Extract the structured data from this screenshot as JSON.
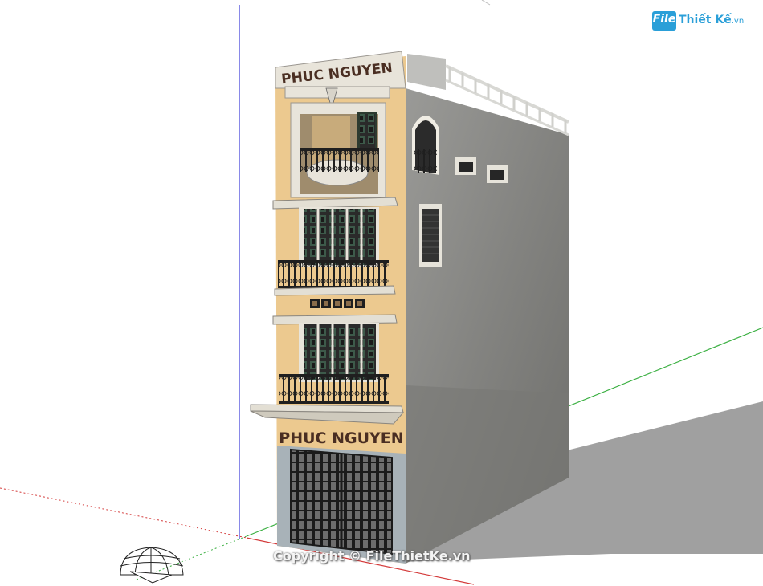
{
  "signage": {
    "top_sign": "PHUC NGUYEN",
    "shop_sign": "PHUC NGUYEN"
  },
  "branding": {
    "logo_box": "File",
    "logo_name": "Thiết Kế",
    "logo_tld": ".vn",
    "watermark": "Copyright © FileThietKe.vn"
  },
  "colors": {
    "facade": "#ecc98f",
    "side_wall": "#8a8a88",
    "trim": "#e8e4da",
    "ironwork": "#1f1f1f",
    "shadow": "#8f8f8f",
    "axis_red": "#d43c3c",
    "axis_green": "#3cb043",
    "axis_blue": "#3b3bd9",
    "brand_blue": "#2a9fd8"
  },
  "icons": [
    "sketchup-origin-dome-icon"
  ]
}
